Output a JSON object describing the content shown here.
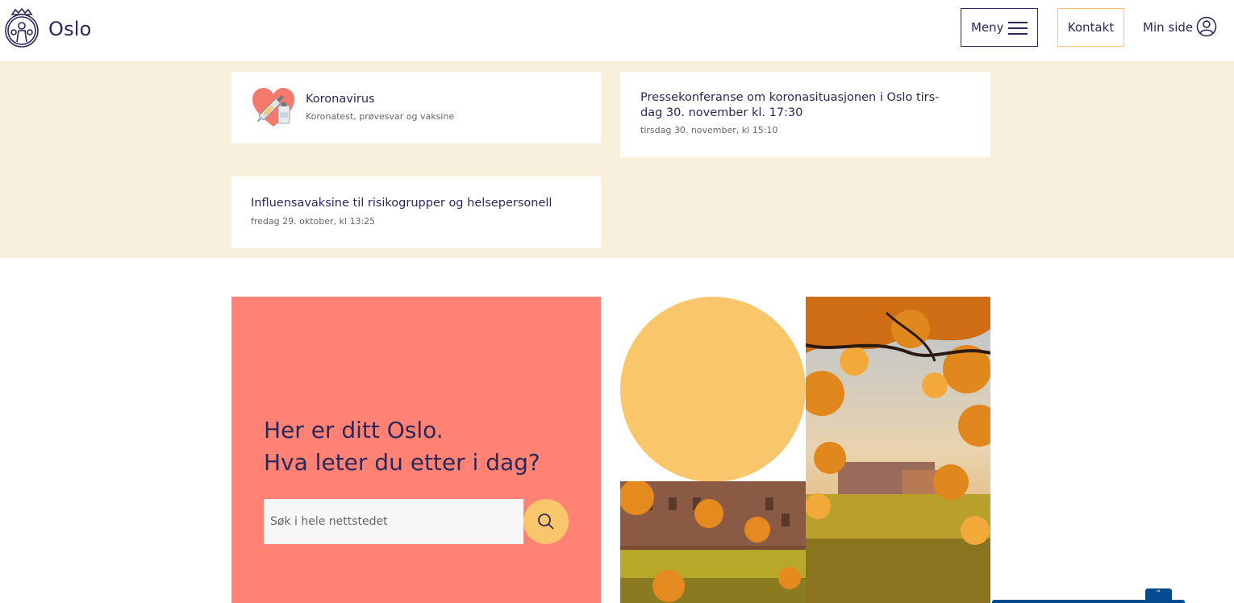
{
  "header": {
    "brand": "Oslo",
    "menu_label": "Meny",
    "contact_label": "Kontakt",
    "mypage_label": "Min side"
  },
  "news": [
    {
      "title": "Koronavirus",
      "subtitle": "Koronatest, prøvesvar og vaksine",
      "icon": "heart-vaccine-icon"
    },
    {
      "title_line1": "Pressekonferanse om koronasituasjonen i Oslo tirs-",
      "title_line2": "dag 30. november kl. 17:30",
      "date": "tirsdag 30. november, kl 15:10"
    },
    {
      "title": "Influensavaksine til risikogrupper og helsepersonell",
      "date": "fredag 29. oktober, kl 13:25"
    }
  ],
  "hero": {
    "line1": "Her er ditt Oslo.",
    "line2": "Hva leter du etter i dag?",
    "search_placeholder": "Søk i hele nettstedet"
  },
  "chat": {
    "tab_glyph": "⌃"
  },
  "colors": {
    "navy": "#2a2859",
    "beige": "#f8f0dd",
    "coral": "#ff8274",
    "yellow": "#f9c66b",
    "blue": "#034b8e"
  }
}
